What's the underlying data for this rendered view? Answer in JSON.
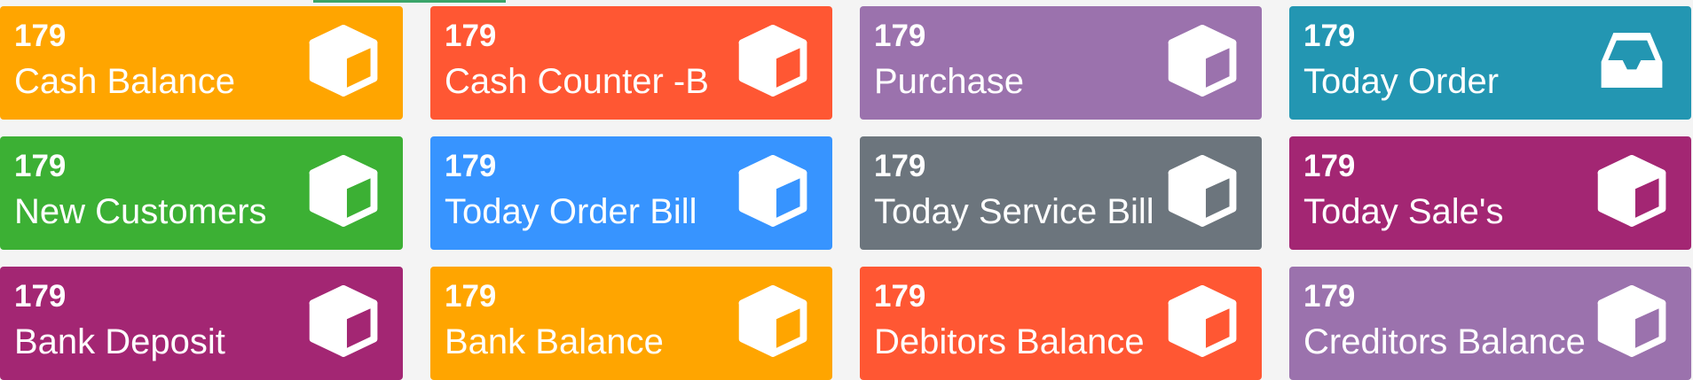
{
  "cards": [
    {
      "count": "179",
      "label": "Cash Balance",
      "color": "#ffa500",
      "icon": "cube-icon"
    },
    {
      "count": "179",
      "label": "Cash Counter -B",
      "color": "#ff5733",
      "icon": "cube-icon"
    },
    {
      "count": "179",
      "label": "Purchase",
      "color": "#9b72ad",
      "icon": "cube-icon"
    },
    {
      "count": "179",
      "label": "Today Order",
      "color": "#2396b2",
      "icon": "inbox-tray-icon"
    },
    {
      "count": "179",
      "label": "New Customers",
      "color": "#3cb034",
      "icon": "cube-icon"
    },
    {
      "count": "179",
      "label": "Today Order Bill",
      "color": "#3794ff",
      "icon": "cube-icon"
    },
    {
      "count": "179",
      "label": "Today Service Bill",
      "color": "#6c757d",
      "icon": "cube-icon"
    },
    {
      "count": "179",
      "label": "Today Sale's",
      "color": "#a32673",
      "icon": "cube-icon"
    },
    {
      "count": "179",
      "label": "Bank Deposit",
      "color": "#a32673",
      "icon": "cube-icon"
    },
    {
      "count": "179",
      "label": "Bank Balance",
      "color": "#ffa500",
      "icon": "cube-icon"
    },
    {
      "count": "179",
      "label": "Debitors Balance",
      "color": "#ff5733",
      "icon": "cube-icon"
    },
    {
      "count": "179",
      "label": "Creditors Balance",
      "color": "#9b72ad",
      "icon": "cube-icon"
    }
  ]
}
